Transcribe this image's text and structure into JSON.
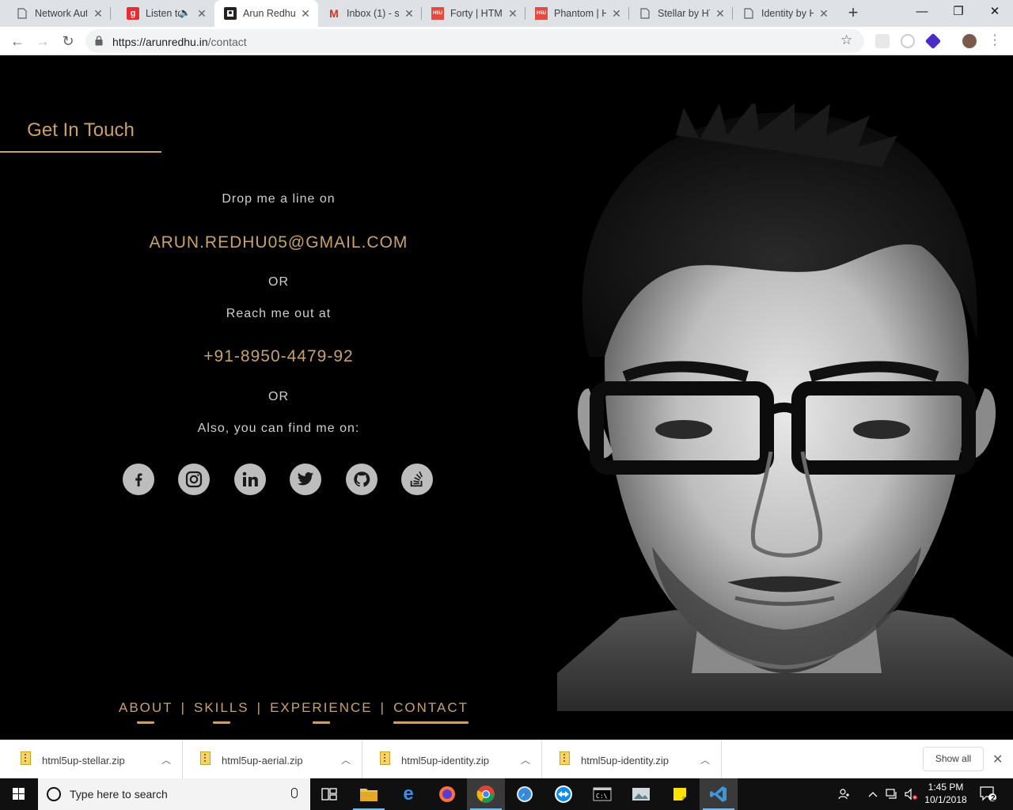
{
  "browser": {
    "tabs": [
      {
        "title": "Network Aut",
        "favicon": "page-icon",
        "active": false
      },
      {
        "title": "Listen to",
        "favicon": "gaana-icon",
        "active": false,
        "audio": true
      },
      {
        "title": "Arun Redhu",
        "favicon": "site-icon",
        "active": true
      },
      {
        "title": "Inbox (1) - s",
        "favicon": "gmail-icon",
        "active": false
      },
      {
        "title": "Forty | HTML",
        "favicon": "html5up-icon",
        "active": false
      },
      {
        "title": "Phantom | H",
        "favicon": "html5up-icon",
        "active": false
      },
      {
        "title": "Stellar by HT",
        "favicon": "page-icon",
        "active": false
      },
      {
        "title": "Identity by H",
        "favicon": "page-icon",
        "active": false
      }
    ],
    "url_host": "https://arunredhu.in",
    "url_path": "/contact"
  },
  "page": {
    "heading": "Get In Touch",
    "drop_line": "Drop me a line on",
    "email": "ARUN.REDHU05@GMAIL.COM",
    "or1": "OR",
    "reach": "Reach me out at",
    "phone": "+91-8950-4479-92",
    "or2": "OR",
    "find": "Also, you can find me on:",
    "socials": [
      "facebook-icon",
      "instagram-icon",
      "linkedin-icon",
      "twitter-icon",
      "github-icon",
      "stackoverflow-icon"
    ],
    "nav": {
      "about": "ABOUT",
      "skills": "SKILLS",
      "experience": "EXPERIENCE",
      "contact": "CONTACT",
      "sep": "|"
    }
  },
  "downloads": {
    "items": [
      "html5up-stellar.zip",
      "html5up-aerial.zip",
      "html5up-identity.zip",
      "html5up-identity.zip"
    ],
    "show_all": "Show all"
  },
  "taskbar": {
    "search_placeholder": "Type here to search",
    "time": "1:45 PM",
    "date": "10/1/2018",
    "notifications": "2"
  }
}
